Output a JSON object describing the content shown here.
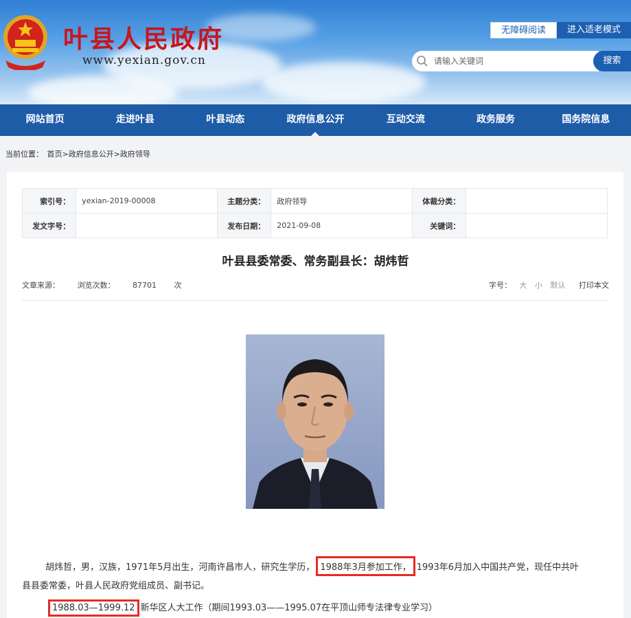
{
  "site": {
    "title": "叶县人民政府",
    "url": "www.yexian.gov.cn",
    "accessibility_label": "无障碍阅读",
    "elder_mode_label": "进入适老模式",
    "search_placeholder": "请输入关键词",
    "search_button": "搜索"
  },
  "nav": [
    {
      "label": "网站首页"
    },
    {
      "label": "走进叶县"
    },
    {
      "label": "叶县动态"
    },
    {
      "label": "政府信息公开",
      "active": true
    },
    {
      "label": "互动交流"
    },
    {
      "label": "政务服务"
    },
    {
      "label": "国务院信息"
    }
  ],
  "breadcrumb": {
    "prefix": "当前位置：",
    "path": "首页>政府信息公开>政府领导"
  },
  "meta": {
    "index_label": "索引号：",
    "index_value": "yexian-2019-00008",
    "topic_label": "主题分类：",
    "topic_value": "政府领导",
    "genre_label": "体裁分类：",
    "genre_value": "",
    "docno_label": "发文字号：",
    "docno_value": "",
    "date_label": "发布日期：",
    "date_value": "2021-09-08",
    "keyword_label": "关键词：",
    "keyword_value": ""
  },
  "article": {
    "title": "叶县县委常委、常务副县长：胡炜哲",
    "source_label": "文章来源：",
    "views_label": "浏览次数：",
    "views_value": "87701",
    "views_unit": "次",
    "font_label": "字号：",
    "font_large": "大",
    "font_small": "小",
    "font_default": "默认",
    "print_label": "打印本文"
  },
  "bio": {
    "line1_a": "胡炜哲，男，汉族，1971年5月出生，河南许昌市人，研究生学历，",
    "line1_hl": "1988年3月参加工作，",
    "line1_b": "1993年6月加入中国共产党，现任中共叶",
    "line2": "县县委常委，叶县人民政府党组成员、副书记。",
    "line3_hl": "1988.03—1999.12",
    "line3_b": "新华区人大工作（期间1993.03——1995.07在平顶山师专法律专业学习）"
  }
}
